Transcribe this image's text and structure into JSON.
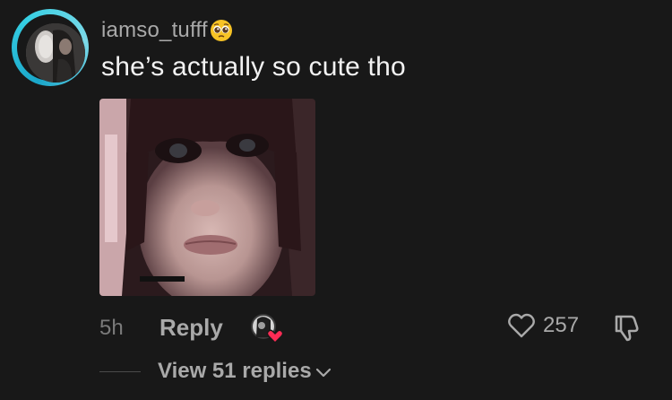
{
  "comment": {
    "username": "iamso_tufff",
    "username_emoji": "pleading-face-emoji",
    "text": "she’s actually so cute tho",
    "timestamp": "5h",
    "reply_label": "Reply",
    "like_count": "257",
    "view_replies_label": "View 51 replies"
  },
  "icons": {
    "like": "heart-outline-icon",
    "dislike": "thumbs-down-icon",
    "creator_liked": "creator-liked-heart-icon",
    "expand": "chevron-down-icon"
  },
  "colors": {
    "background": "#181818",
    "avatar_ring": "#36d0e4",
    "creator_heart": "#fe2c55"
  }
}
